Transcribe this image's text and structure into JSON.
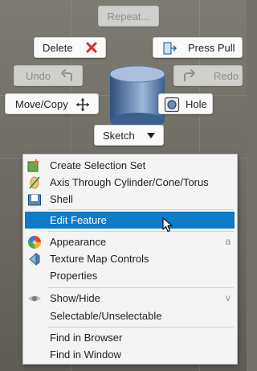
{
  "marking_menu": {
    "repeat_label": "Repeat...",
    "delete_label": "Delete",
    "press_pull_label": "Press Pull",
    "undo_label": "Undo",
    "redo_label": "Redo",
    "move_copy_label": "Move/Copy",
    "hole_label": "Hole",
    "sketch_label": "Sketch"
  },
  "context_menu": {
    "items": [
      {
        "label": "Create Selection Set",
        "icon": "selection-set-icon"
      },
      {
        "label": "Axis Through Cylinder/Cone/Torus",
        "icon": "axis-icon"
      },
      {
        "label": "Shell",
        "icon": "shell-icon"
      },
      {
        "label": "Edit Feature",
        "selected": true
      },
      {
        "label": "Appearance",
        "icon": "appearance-icon",
        "shortcut": "a"
      },
      {
        "label": "Texture Map Controls",
        "icon": "texture-map-icon"
      },
      {
        "label": "Properties"
      },
      {
        "label": "Show/Hide",
        "icon": "eye-icon",
        "shortcut": "v"
      },
      {
        "label": "Selectable/Unselectable"
      },
      {
        "label": "Find in Browser"
      },
      {
        "label": "Find in Window"
      }
    ]
  },
  "colors": {
    "selection": "#0f7ac5",
    "delete_x": "#e0282e",
    "background": "#737168"
  }
}
